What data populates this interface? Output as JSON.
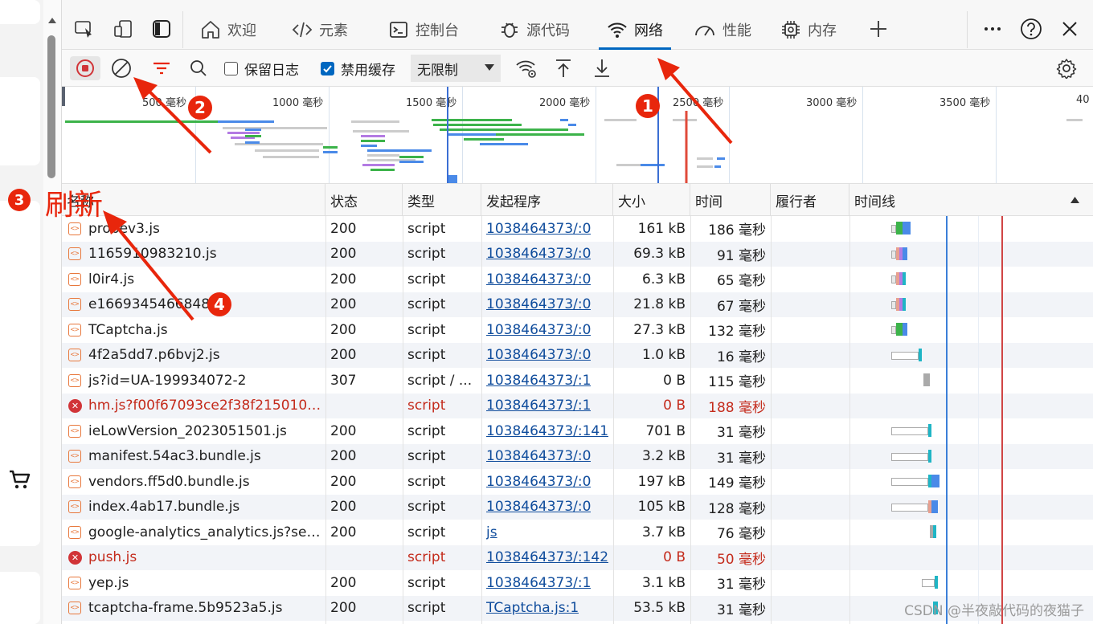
{
  "tabs": [
    {
      "label": "欢迎",
      "icon": "home-icon"
    },
    {
      "label": "元素",
      "icon": "code-icon"
    },
    {
      "label": "控制台",
      "icon": "console-icon"
    },
    {
      "label": "源代码",
      "icon": "bug-icon"
    },
    {
      "label": "网络",
      "icon": "wifi-icon",
      "active": true
    },
    {
      "label": "性能",
      "icon": "gauge-icon"
    },
    {
      "label": "内存",
      "icon": "chip-icon"
    }
  ],
  "toolbar": {
    "preserve_log": "保留日志",
    "disable_cache": "禁用缓存",
    "throttle": "无限制"
  },
  "overview": {
    "ticks": [
      "500 毫秒",
      "1000 毫秒",
      "1500 毫秒",
      "2000 毫秒",
      "2500 毫秒",
      "3000 毫秒",
      "3500 毫秒",
      "40"
    ]
  },
  "columns": [
    "名称",
    "状态",
    "类型",
    "发起程序",
    "大小",
    "时间",
    "履行者",
    "时间线"
  ],
  "rows": [
    {
      "name": "probev3.js",
      "status": "200",
      "type": "script",
      "initiator": "1038464373/:0",
      "size": "161 kB",
      "time": "186 毫秒"
    },
    {
      "name": "1165910983210.js",
      "status": "200",
      "type": "script",
      "initiator": "1038464373/:0",
      "size": "69.3 kB",
      "time": "91 毫秒"
    },
    {
      "name": "l0ir4.js",
      "status": "200",
      "type": "script",
      "initiator": "1038464373/:0",
      "size": "6.3 kB",
      "time": "65 毫秒"
    },
    {
      "name": "e1669345466848.js",
      "status": "200",
      "type": "script",
      "initiator": "1038464373/:0",
      "size": "21.8 kB",
      "time": "67 毫秒"
    },
    {
      "name": "TCaptcha.js",
      "status": "200",
      "type": "script",
      "initiator": "1038464373/:0",
      "size": "27.3 kB",
      "time": "132 毫秒"
    },
    {
      "name": "4f2a5dd7.p6bvj2.js",
      "status": "200",
      "type": "script",
      "initiator": "1038464373/:0",
      "size": "1.0 kB",
      "time": "16 毫秒"
    },
    {
      "name": "js?id=UA-199934072-2",
      "status": "307",
      "type": "script / ...",
      "initiator": "1038464373/:1",
      "size": "0 B",
      "time": "115 毫秒"
    },
    {
      "name": "hm.js?f00f67093ce2f38f215010b6...",
      "status": "",
      "type": "script",
      "initiator": "1038464373/:1",
      "size": "0 B",
      "time": "188 毫秒",
      "error": true
    },
    {
      "name": "ieLowVersion_2023051501.js",
      "status": "200",
      "type": "script",
      "initiator": "1038464373/:141",
      "size": "701 B",
      "time": "31 毫秒"
    },
    {
      "name": "manifest.54ac3.bundle.js",
      "status": "200",
      "type": "script",
      "initiator": "1038464373/:0",
      "size": "3.2 kB",
      "time": "31 毫秒"
    },
    {
      "name": "vendors.ff5d0.bundle.js",
      "status": "200",
      "type": "script",
      "initiator": "1038464373/:0",
      "size": "197 kB",
      "time": "149 毫秒"
    },
    {
      "name": "index.4ab17.bundle.js",
      "status": "200",
      "type": "script",
      "initiator": "1038464373/:0",
      "size": "105 kB",
      "time": "128 毫秒"
    },
    {
      "name": "google-analytics_analytics.js?secre...",
      "status": "200",
      "type": "script",
      "initiator": "js",
      "size": "3.7 kB",
      "time": "76 毫秒"
    },
    {
      "name": "push.js",
      "status": "",
      "type": "script",
      "initiator": "1038464373/:142",
      "size": "0 B",
      "time": "50 毫秒",
      "error": true
    },
    {
      "name": "yep.js",
      "status": "200",
      "type": "script",
      "initiator": "1038464373/:1",
      "size": "3.1 kB",
      "time": "31 毫秒"
    },
    {
      "name": "tcaptcha-frame.5b9523a5.js",
      "status": "200",
      "type": "script",
      "initiator": "TCaptcha.js:1",
      "size": "53.5 kB",
      "time": "31 毫秒"
    }
  ],
  "annotations": {
    "b1": "1",
    "b2": "2",
    "b3": "3",
    "b4": "4",
    "refresh_label": "刷新"
  },
  "watermark": "CSDN @半夜敲代码的夜猫子",
  "colors": {
    "accent": "#0067c0",
    "annotation": "#e8260c",
    "error": "#c42b1c"
  }
}
